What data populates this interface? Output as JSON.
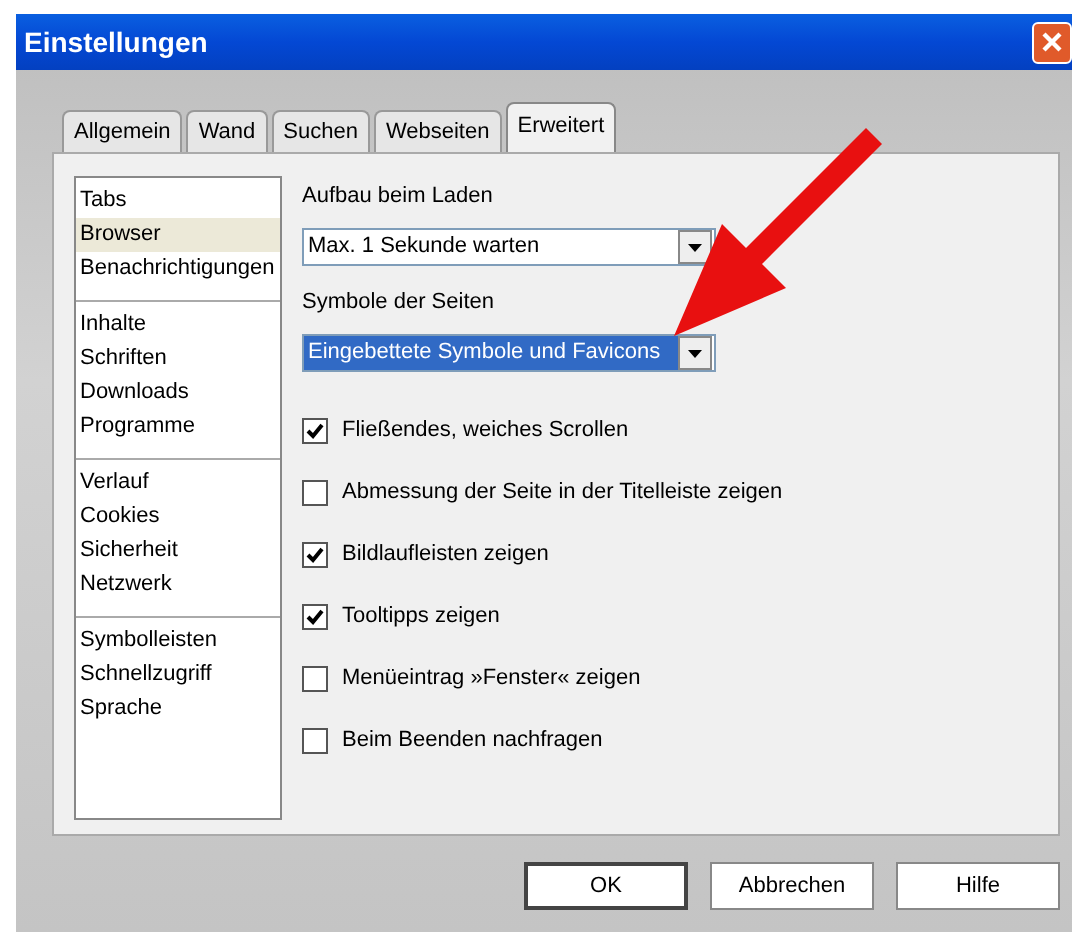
{
  "window": {
    "title": "Einstellungen"
  },
  "tabs": [
    {
      "label": "Allgemein",
      "selected": false
    },
    {
      "label": "Wand",
      "selected": false
    },
    {
      "label": "Suchen",
      "selected": false
    },
    {
      "label": "Webseiten",
      "selected": false
    },
    {
      "label": "Erweitert",
      "selected": true
    }
  ],
  "sidebar": {
    "groups": [
      {
        "items": [
          {
            "label": "Tabs",
            "selected": false
          },
          {
            "label": "Browser",
            "selected": true
          },
          {
            "label": "Benachrichtigungen",
            "selected": false
          }
        ]
      },
      {
        "items": [
          {
            "label": "Inhalte",
            "selected": false
          },
          {
            "label": "Schriften",
            "selected": false
          },
          {
            "label": "Downloads",
            "selected": false
          },
          {
            "label": "Programme",
            "selected": false
          }
        ]
      },
      {
        "items": [
          {
            "label": "Verlauf",
            "selected": false
          },
          {
            "label": "Cookies",
            "selected": false
          },
          {
            "label": "Sicherheit",
            "selected": false
          },
          {
            "label": "Netzwerk",
            "selected": false
          }
        ]
      },
      {
        "items": [
          {
            "label": "Symbolleisten",
            "selected": false
          },
          {
            "label": "Schnellzugriff",
            "selected": false
          },
          {
            "label": "Sprache",
            "selected": false
          }
        ]
      }
    ]
  },
  "dropdowns": [
    {
      "label": "Aufbau beim Laden",
      "value": "Max. 1 Sekunde warten",
      "highlighted": false
    },
    {
      "label": "Symbole der Seiten",
      "value": "Eingebettete Symbole und Favicons",
      "highlighted": true
    }
  ],
  "options": [
    {
      "label": "Fließendes, weiches Scrollen",
      "checked": true
    },
    {
      "label": "Abmessung der Seite in der Titelleiste zeigen",
      "checked": false
    },
    {
      "label": "Bildlaufleisten zeigen",
      "checked": true
    },
    {
      "label": "Tooltipps zeigen",
      "checked": true
    },
    {
      "label": "Menüeintrag »Fenster« zeigen",
      "checked": false
    },
    {
      "label": "Beim Beenden nachfragen",
      "checked": false
    }
  ],
  "buttons": [
    {
      "label": "OK",
      "default": true
    },
    {
      "label": "Abbrechen",
      "default": false
    },
    {
      "label": "Hilfe",
      "default": false
    }
  ],
  "annotations": [
    {
      "kind": "arrow"
    }
  ]
}
